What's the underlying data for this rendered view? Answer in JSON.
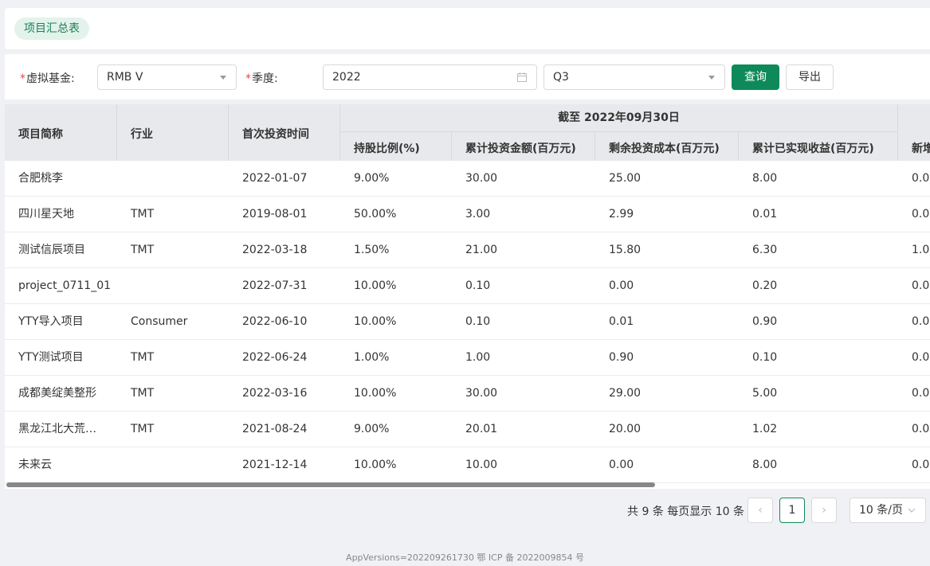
{
  "tab": {
    "label": "项目汇总表"
  },
  "filters": {
    "fund_label": "虚拟基金:",
    "fund_value": "RMB V",
    "quarter_label": "季度:",
    "year_value": "2022",
    "quarter_value": "Q3",
    "query_button": "查询",
    "export_button": "导出",
    "required_mark": "*"
  },
  "table": {
    "group_header": "截至 2022年09月30日",
    "columns": [
      "项目简称",
      "行业",
      "首次投资时间",
      "持股比例(%)",
      "累计投资金额(百万元)",
      "剩余投资成本(百万元)",
      "累计已实现收益(百万元)",
      "新增"
    ],
    "rows": [
      [
        "合肥桃李",
        "",
        "2022-01-07",
        "9.00%",
        "30.00",
        "25.00",
        "8.00",
        "0.0"
      ],
      [
        "四川星天地",
        "TMT",
        "2019-08-01",
        "50.00%",
        "3.00",
        "2.99",
        "0.01",
        "0.0"
      ],
      [
        "测试信辰项目",
        "TMT",
        "2022-03-18",
        "1.50%",
        "21.00",
        "15.80",
        "6.30",
        "1.0"
      ],
      [
        "project_0711_01",
        "",
        "2022-07-31",
        "10.00%",
        "0.10",
        "0.00",
        "0.20",
        "0.0"
      ],
      [
        "YTY导入项目",
        "Consumer",
        "2022-06-10",
        "10.00%",
        "0.10",
        "0.01",
        "0.90",
        "0.0"
      ],
      [
        "YTY测试项目",
        "TMT",
        "2022-06-24",
        "1.00%",
        "1.00",
        "0.90",
        "0.10",
        "0.0"
      ],
      [
        "成都美绽美整形",
        "TMT",
        "2022-03-16",
        "10.00%",
        "30.00",
        "29.00",
        "5.00",
        "0.0"
      ],
      [
        "黑龙江北大荒…",
        "TMT",
        "2021-08-24",
        "9.00%",
        "20.01",
        "20.00",
        "1.02",
        "0.0"
      ],
      [
        "未来云",
        "",
        "2021-12-14",
        "10.00%",
        "10.00",
        "0.00",
        "8.00",
        "0.0"
      ]
    ]
  },
  "pagination": {
    "total_text": "共 9 条  每页显示 10 条",
    "prev": "‹",
    "current_page": "1",
    "next": "›",
    "page_size": "10 条/页"
  },
  "footer": {
    "text": "AppVersions=202209261730  鄂 ICP 备 2022009854 号"
  }
}
